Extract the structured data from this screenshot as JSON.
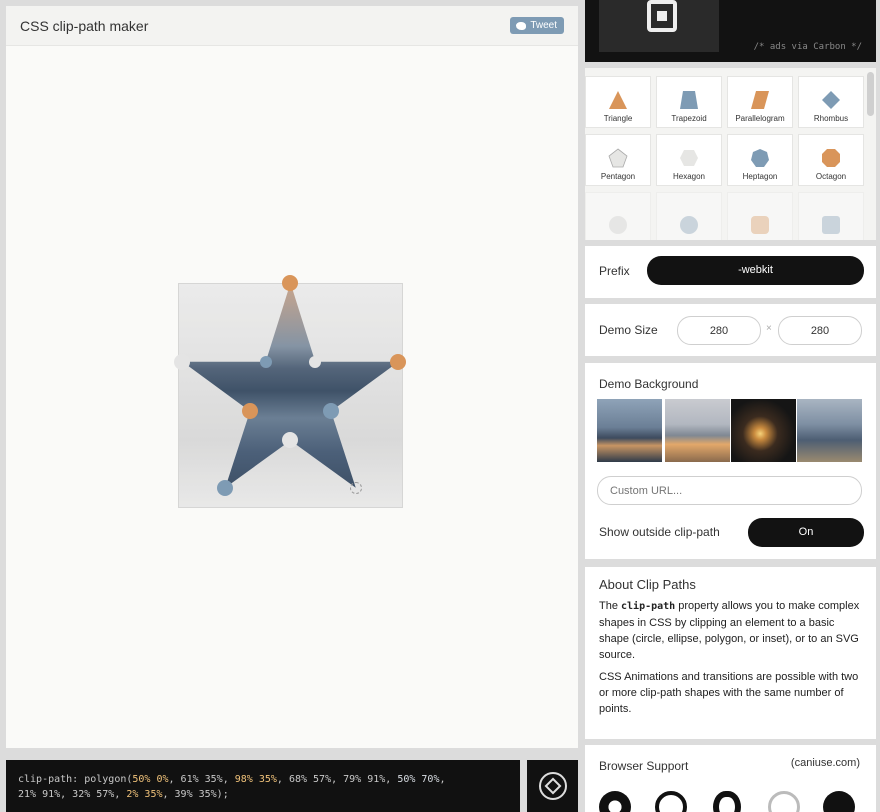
{
  "app": {
    "title": "CSS clip-path maker",
    "tweet_label": "Tweet"
  },
  "code": {
    "line1_a": "clip-path: polygon(",
    "p1": "50% 0%",
    "sep1": ", 61% 35%, ",
    "p3": "98% 35%",
    "sep2": ", 68% 57%, 79% 91%, ",
    "p6": "50% 70%",
    "sep3": ",",
    "line2_a": "21% 91%, 32% 57%, ",
    "p9": "2% 35%",
    "line2_b": ", 39% 35%);"
  },
  "ad": {
    "text": "/* ads via Carbon */"
  },
  "shapes": [
    {
      "label": "Triangle",
      "icon": "triangle-icon"
    },
    {
      "label": "Trapezoid",
      "icon": "trapezoid-icon"
    },
    {
      "label": "Parallelogram",
      "icon": "parallelogram-icon"
    },
    {
      "label": "Rhombus",
      "icon": "rhombus-icon"
    },
    {
      "label": "Pentagon",
      "icon": "pentagon-icon"
    },
    {
      "label": "Hexagon",
      "icon": "hexagon-icon"
    },
    {
      "label": "Heptagon",
      "icon": "heptagon-icon"
    },
    {
      "label": "Octagon",
      "icon": "octagon-icon"
    }
  ],
  "prefix": {
    "label": "Prefix",
    "value": "-webkit"
  },
  "demo_size": {
    "label": "Demo Size",
    "width": "280",
    "times": "×",
    "height": "280"
  },
  "demo_background": {
    "label": "Demo Background",
    "url_placeholder": "Custom URL...",
    "show_outside_label": "Show outside clip-path",
    "show_outside_value": "On"
  },
  "about": {
    "title": "About Clip Paths",
    "p1_a": "The ",
    "p1_code": "clip-path",
    "p1_b": " property allows you to make complex shapes in CSS by clipping an element to a basic shape (circle, ellipse, polygon, or inset), or to an SVG source.",
    "p2": "CSS Animations and transitions are possible with two or more clip-path shapes with the same number of points."
  },
  "browser_support": {
    "title": "Browser Support",
    "link": "(caniuse.com)"
  },
  "colors": {
    "accent_orange": "#d9955a",
    "accent_blue": "#7e9bb4",
    "dark": "#121212"
  }
}
